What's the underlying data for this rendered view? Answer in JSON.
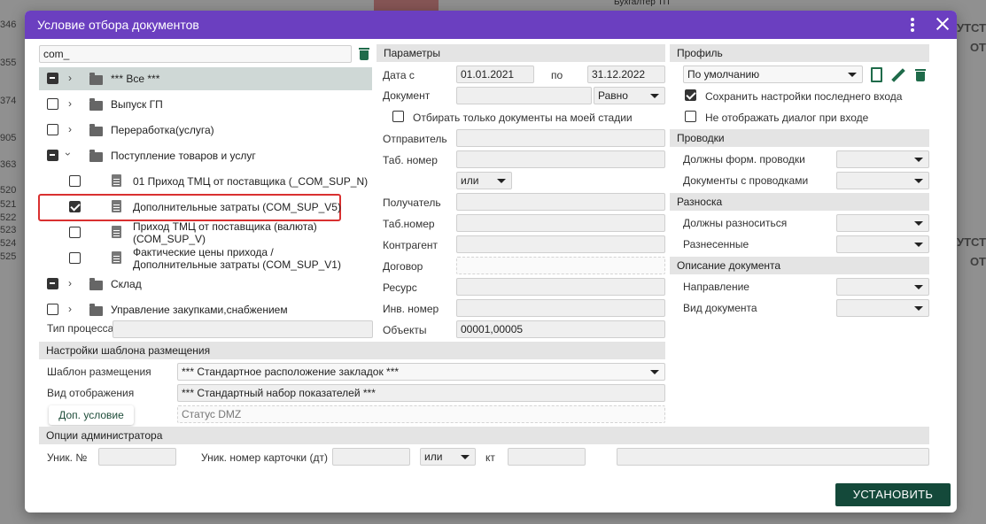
{
  "background": {
    "row_numbers": [
      "346",
      "355",
      "374",
      "905",
      "363",
      "520",
      "521",
      "522",
      "523",
      "524",
      "525"
    ],
    "right_texts": [
      "УТСТВ",
      "ОТ",
      "УТСТВ",
      "ОТ"
    ],
    "top_text": "Бухгалтер ТП"
  },
  "dialog": {
    "title": "Условие отбора документов",
    "menu_icon": "more-vert-icon",
    "close_icon": "close-icon"
  },
  "tree": {
    "search_value": "com_",
    "items": [
      {
        "label": "*** Все ***",
        "state": "partial",
        "expand": "collapsed"
      },
      {
        "label": "Выпуск ГП",
        "state": "unchecked",
        "expand": "collapsed"
      },
      {
        "label": "Переработка(услуга)",
        "state": "unchecked",
        "expand": "collapsed"
      },
      {
        "label": "Поступление товаров и услуг",
        "state": "partial",
        "expand": "expanded"
      },
      {
        "label": "01 Приход ТМЦ от поставщика (_COM_SUP_N)",
        "state": "unchecked"
      },
      {
        "label": "Дополнительные затраты (COM_SUP_V5)",
        "state": "checked"
      },
      {
        "label": "Приход ТМЦ от поставщика (валюта) (COM_SUP_V)",
        "state": "unchecked"
      },
      {
        "label": "Фактические цены прихода / Дополнительные затраты (COM_SUP_V1)",
        "state": "unchecked"
      },
      {
        "label": "Склад",
        "state": "partial",
        "expand": "collapsed"
      },
      {
        "label": "Управление закупками,снабжением",
        "state": "unchecked",
        "expand": "collapsed"
      }
    ],
    "process_type_label": "Тип процесса",
    "process_type_value": ""
  },
  "params": {
    "header": "Параметры",
    "date_from_label": "Дата с",
    "date_from": "01.01.2021",
    "date_to_label": "по",
    "date_to": "31.12.2022",
    "document_label": "Документ",
    "document_value": "",
    "document_op": "Равно",
    "only_my_stage_label": "Отбирать только документы на моей стадии",
    "sender_label": "Отправитель",
    "tab_num_label": "Таб. номер",
    "logic_op": "или",
    "recipient_label": "Получатель",
    "tab_num2_label": "Таб.номер",
    "counterparty_label": "Контрагент",
    "contract_label": "Договор",
    "resource_label": "Ресурс",
    "inv_num_label": "Инв. номер",
    "objects_label": "Объекты",
    "objects_value": "00001,00005"
  },
  "profile": {
    "header": "Профиль",
    "selected": "По умолчанию",
    "save_last_label": "Сохранить настройки последнего входа",
    "save_last_checked": true,
    "no_dialog_label": "Не отображать диалог при входе",
    "no_dialog_checked": false
  },
  "postings": {
    "header": "Проводки",
    "must_form_label": "Должны форм. проводки",
    "with_postings_label": "Документы с проводками"
  },
  "distribution": {
    "header": "Разноска",
    "must_distribute_label": "Должны разноситься",
    "distributed_label": "Разнесенные"
  },
  "doc_desc": {
    "header": "Описание документа",
    "direction_label": "Направление",
    "doc_type_label": "Вид документа"
  },
  "template": {
    "header": "Настройки шаблона размещения",
    "layout_label": "Шаблон размещения",
    "layout_value": "*** Стандартное расположение закладок ***",
    "view_label": "Вид отображения",
    "view_value": "*** Стандартный набор показателей ***",
    "extra_condition_button": "Доп. условие",
    "status_placeholder": "Статус DMZ"
  },
  "admin": {
    "header": "Опции администратора",
    "unique_num_label": "Уник. №",
    "card_num_label": "Уник. номер карточки (дт)",
    "logic_op": "или",
    "kt_label": "кт"
  },
  "actions": {
    "install_button": "УСТАНОВИТЬ"
  },
  "colors": {
    "titlebar": "#6b3fc0",
    "primary_button": "#14493a",
    "icon_green": "#1f6b4a",
    "highlight": "#d93030"
  }
}
